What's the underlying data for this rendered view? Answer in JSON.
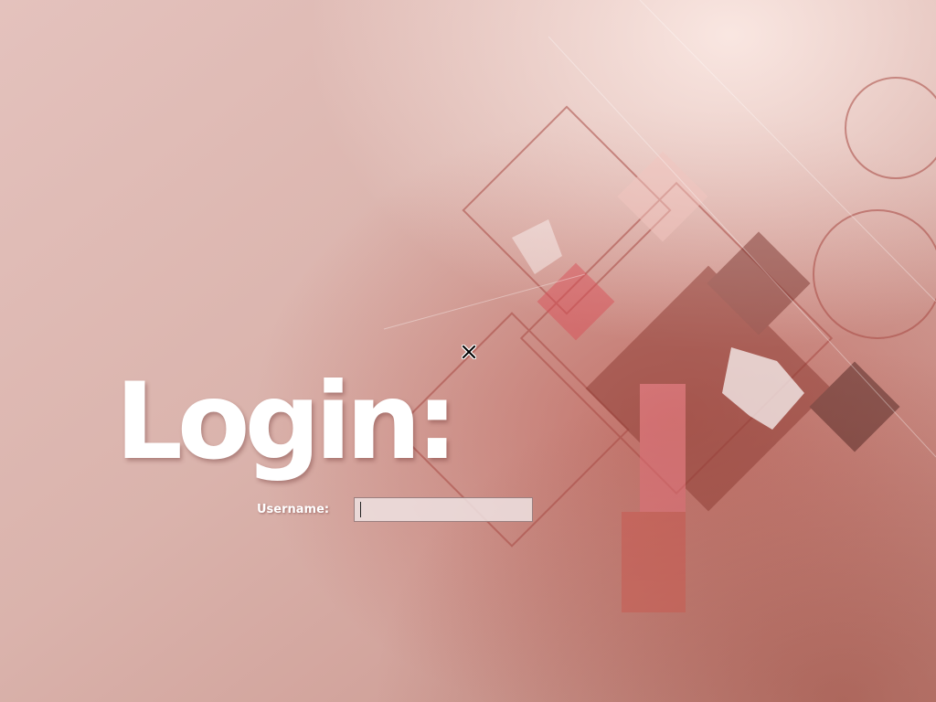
{
  "login": {
    "title": "Login:",
    "username_label": "Username:",
    "username_value": "",
    "username_placeholder": ""
  },
  "colors": {
    "background": "#e6c4bf",
    "accent": "#c94a4a",
    "text": "#ffffff"
  },
  "icons": {
    "pointer": "x-cursor-icon"
  }
}
